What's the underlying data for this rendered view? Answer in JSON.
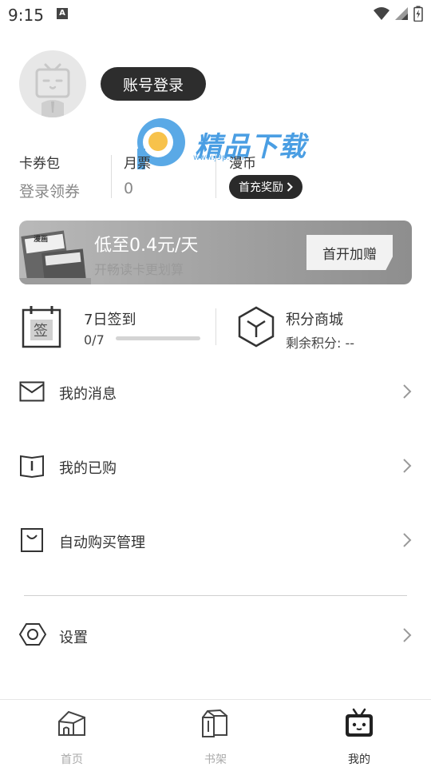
{
  "status_bar": {
    "time": "9:15",
    "notif": "A"
  },
  "profile": {
    "login_label": "账号登录"
  },
  "watermark": {
    "text": "精品下载",
    "url": "www.j9p.com"
  },
  "stats": [
    {
      "label": "卡券包",
      "value": "登录领券"
    },
    {
      "label": "月票",
      "value": "0"
    },
    {
      "label": "漫币",
      "button": "首充奖励"
    }
  ],
  "banner": {
    "title": "低至0.4元/天",
    "subtitle": "开畅读卡更划算",
    "button": "首开加赠",
    "book_text": "漫画"
  },
  "checkin": {
    "icon_text": "签",
    "title": "7日签到",
    "progress_text": "0/7",
    "progress": 0.0
  },
  "points": {
    "title": "积分商城",
    "balance_label": "剩余积分: --"
  },
  "menu": [
    {
      "label": "我的消息",
      "icon": "mail-icon"
    },
    {
      "label": "我的已购",
      "icon": "book-icon"
    },
    {
      "label": "自动购买管理",
      "icon": "bag-icon"
    },
    {
      "label": "设置",
      "icon": "settings-hex-icon"
    }
  ],
  "nav": [
    {
      "label": "首页",
      "icon": "home-icon"
    },
    {
      "label": "书架",
      "icon": "bookshelf-icon"
    },
    {
      "label": "我的",
      "icon": "tv-mascot-icon"
    }
  ]
}
